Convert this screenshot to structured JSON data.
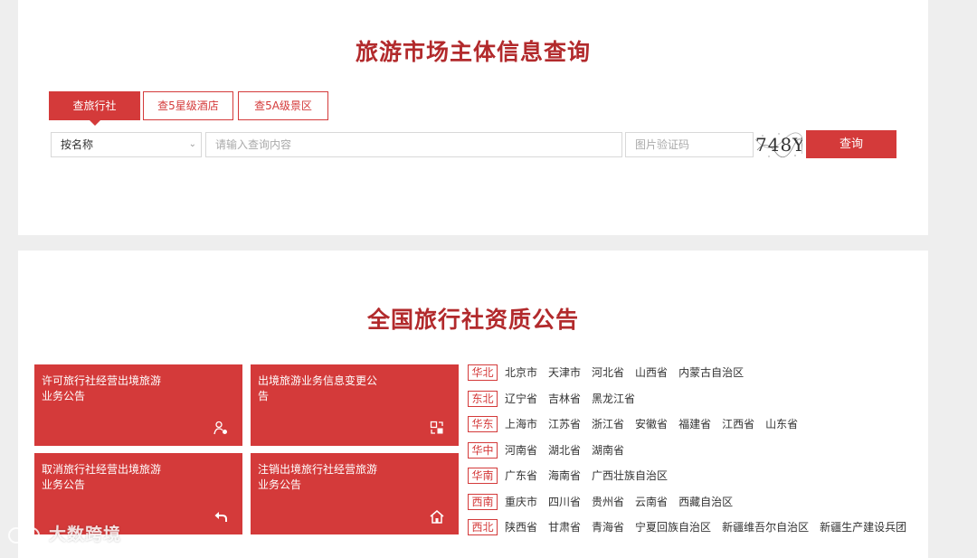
{
  "query": {
    "title": "旅游市场主体信息查询",
    "tabs": [
      {
        "label": "查旅行社",
        "active": true
      },
      {
        "label": "查5星级酒店",
        "active": false
      },
      {
        "label": "查5A级景区",
        "active": false
      }
    ],
    "type_select": {
      "selected": "按名称"
    },
    "search_input": {
      "placeholder": "请输入查询内容",
      "value": ""
    },
    "captcha_input": {
      "placeholder": "图片验证码",
      "value": ""
    },
    "captcha_code": "748Y",
    "query_button": "查询"
  },
  "notice": {
    "title": "全国旅行社资质公告",
    "cards": [
      {
        "label": "许可旅行社经营出境旅游业务公告",
        "icon": "user-check-icon"
      },
      {
        "label": "出境旅游业务信息变更公告",
        "icon": "exchange-icon"
      },
      {
        "label": "取消旅行社经营出境旅游业务公告",
        "icon": "undo-icon"
      },
      {
        "label": "注销出境旅行社经营旅游业务公告",
        "icon": "house-icon"
      }
    ],
    "regions": [
      {
        "name": "华北",
        "provinces": [
          "北京市",
          "天津市",
          "河北省",
          "山西省",
          "内蒙古自治区"
        ]
      },
      {
        "name": "东北",
        "provinces": [
          "辽宁省",
          "吉林省",
          "黑龙江省"
        ]
      },
      {
        "name": "华东",
        "provinces": [
          "上海市",
          "江苏省",
          "浙江省",
          "安徽省",
          "福建省",
          "江西省",
          "山东省"
        ]
      },
      {
        "name": "华中",
        "provinces": [
          "河南省",
          "湖北省",
          "湖南省"
        ]
      },
      {
        "name": "华南",
        "provinces": [
          "广东省",
          "海南省",
          "广西壮族自治区"
        ]
      },
      {
        "name": "西南",
        "provinces": [
          "重庆市",
          "四川省",
          "贵州省",
          "云南省",
          "西藏自治区"
        ]
      },
      {
        "name": "西北",
        "provinces": [
          "陕西省",
          "甘肃省",
          "青海省",
          "宁夏回族自治区",
          "新疆维吾尔自治区",
          "新疆生产建设兵团"
        ]
      }
    ]
  },
  "watermark": "大数跨境",
  "colors": {
    "accent": "#d43a3a",
    "title": "#b22a2c",
    "background": "#eeeeee"
  }
}
